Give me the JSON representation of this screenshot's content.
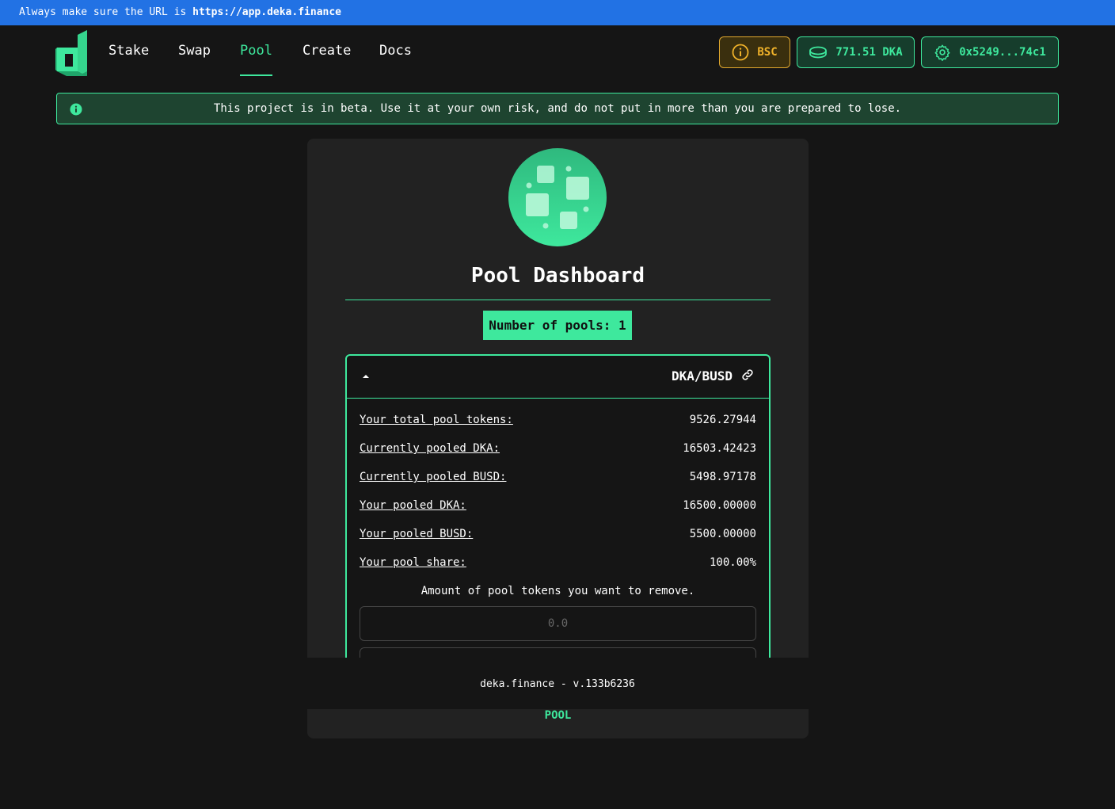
{
  "url_bar": {
    "prefix": "Always make sure the URL is",
    "url": "https://app.deka.finance"
  },
  "nav": {
    "links": [
      {
        "label": "Stake"
      },
      {
        "label": "Swap"
      },
      {
        "label": "Pool"
      },
      {
        "label": "Create"
      },
      {
        "label": "Docs"
      }
    ],
    "active": "Pool"
  },
  "header_buttons": {
    "network": "BSC",
    "balance": "771.51 DKA",
    "address": "0x5249...74c1"
  },
  "beta_notice": "This project is in beta. Use it at your own risk, and do not put in more than you are prepared to lose.",
  "dashboard": {
    "title": "Pool Dashboard",
    "pool_count": "Number of pools: 1",
    "pool": {
      "pair": "DKA/BUSD",
      "rows": [
        {
          "label": "Your total pool tokens:",
          "value": "9526.27944"
        },
        {
          "label": "Currently pooled DKA:",
          "value": "16503.42423"
        },
        {
          "label": "Currently pooled BUSD:",
          "value": "5498.97178"
        },
        {
          "label": "Your pooled DKA:",
          "value": "16500.00000"
        },
        {
          "label": "Your pooled BUSD:",
          "value": "5500.00000"
        },
        {
          "label": "Your pool share:",
          "value": "100.00%"
        }
      ],
      "remove_label": "Amount of pool tokens you want to remove.",
      "amount_placeholder": "0.0"
    },
    "bottom_tab": "POOL"
  },
  "footer": "deka.finance - v.133b6236",
  "colors": {
    "accent": "#3ee89d",
    "url_bar": "#2272e4",
    "warning": "#f0b22a",
    "background": "#151515",
    "card": "#222222"
  }
}
